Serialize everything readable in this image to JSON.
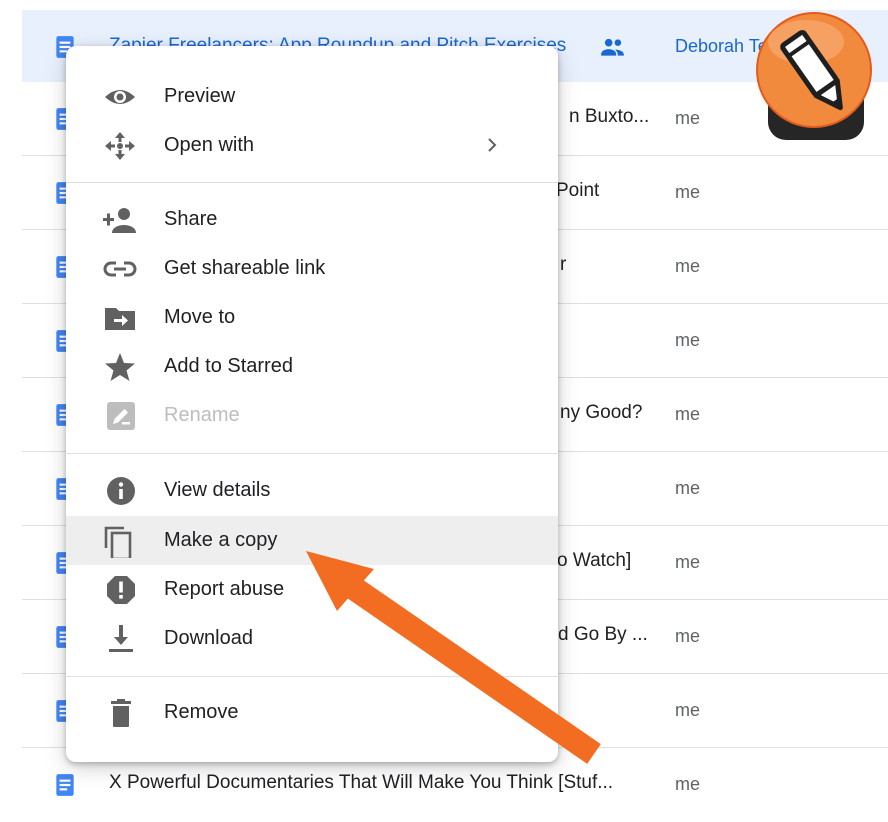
{
  "files": [
    {
      "name": "Zapier Freelancers: App Roundup and Pitch Exercises",
      "owner": "Deborah Ten",
      "shared": true,
      "selected": true
    },
    {
      "name": "n Buxto...",
      "owner": "me"
    },
    {
      "name": "Point",
      "owner": "me"
    },
    {
      "name": "r",
      "owner": "me"
    },
    {
      "name": "",
      "owner": "me"
    },
    {
      "name": "ny Good?",
      "owner": "me"
    },
    {
      "name": "",
      "owner": "me"
    },
    {
      "name": "o Watch]",
      "owner": "me"
    },
    {
      "name": "d Go By ...",
      "owner": "me"
    },
    {
      "name": "",
      "owner": "me"
    },
    {
      "name": "X Powerful Documentaries That Will Make You Think [Stuf...",
      "owner": "me"
    }
  ],
  "menu": {
    "items": [
      {
        "label": "Preview",
        "icon": "eye-icon"
      },
      {
        "label": "Open with",
        "icon": "move-arrows-icon",
        "submenu": true
      },
      {
        "label": "Share",
        "icon": "add-person-icon"
      },
      {
        "label": "Get shareable link",
        "icon": "link-icon"
      },
      {
        "label": "Move to",
        "icon": "folder-move-icon"
      },
      {
        "label": "Add to Starred",
        "icon": "star-icon"
      },
      {
        "label": "Rename",
        "icon": "edit-icon",
        "disabled": true
      },
      {
        "label": "View details",
        "icon": "info-icon"
      },
      {
        "label": "Make a copy",
        "icon": "copy-icon",
        "highlighted": true
      },
      {
        "label": "Report abuse",
        "icon": "report-icon"
      },
      {
        "label": "Download",
        "icon": "download-icon"
      },
      {
        "label": "Remove",
        "icon": "trash-icon"
      }
    ]
  },
  "colors": {
    "doc_blue": "#4285f4",
    "selected_row": "#e8f0fe",
    "selected_text": "#1967d2",
    "menu_icon": "#616161",
    "arrow": "#f26d21"
  }
}
